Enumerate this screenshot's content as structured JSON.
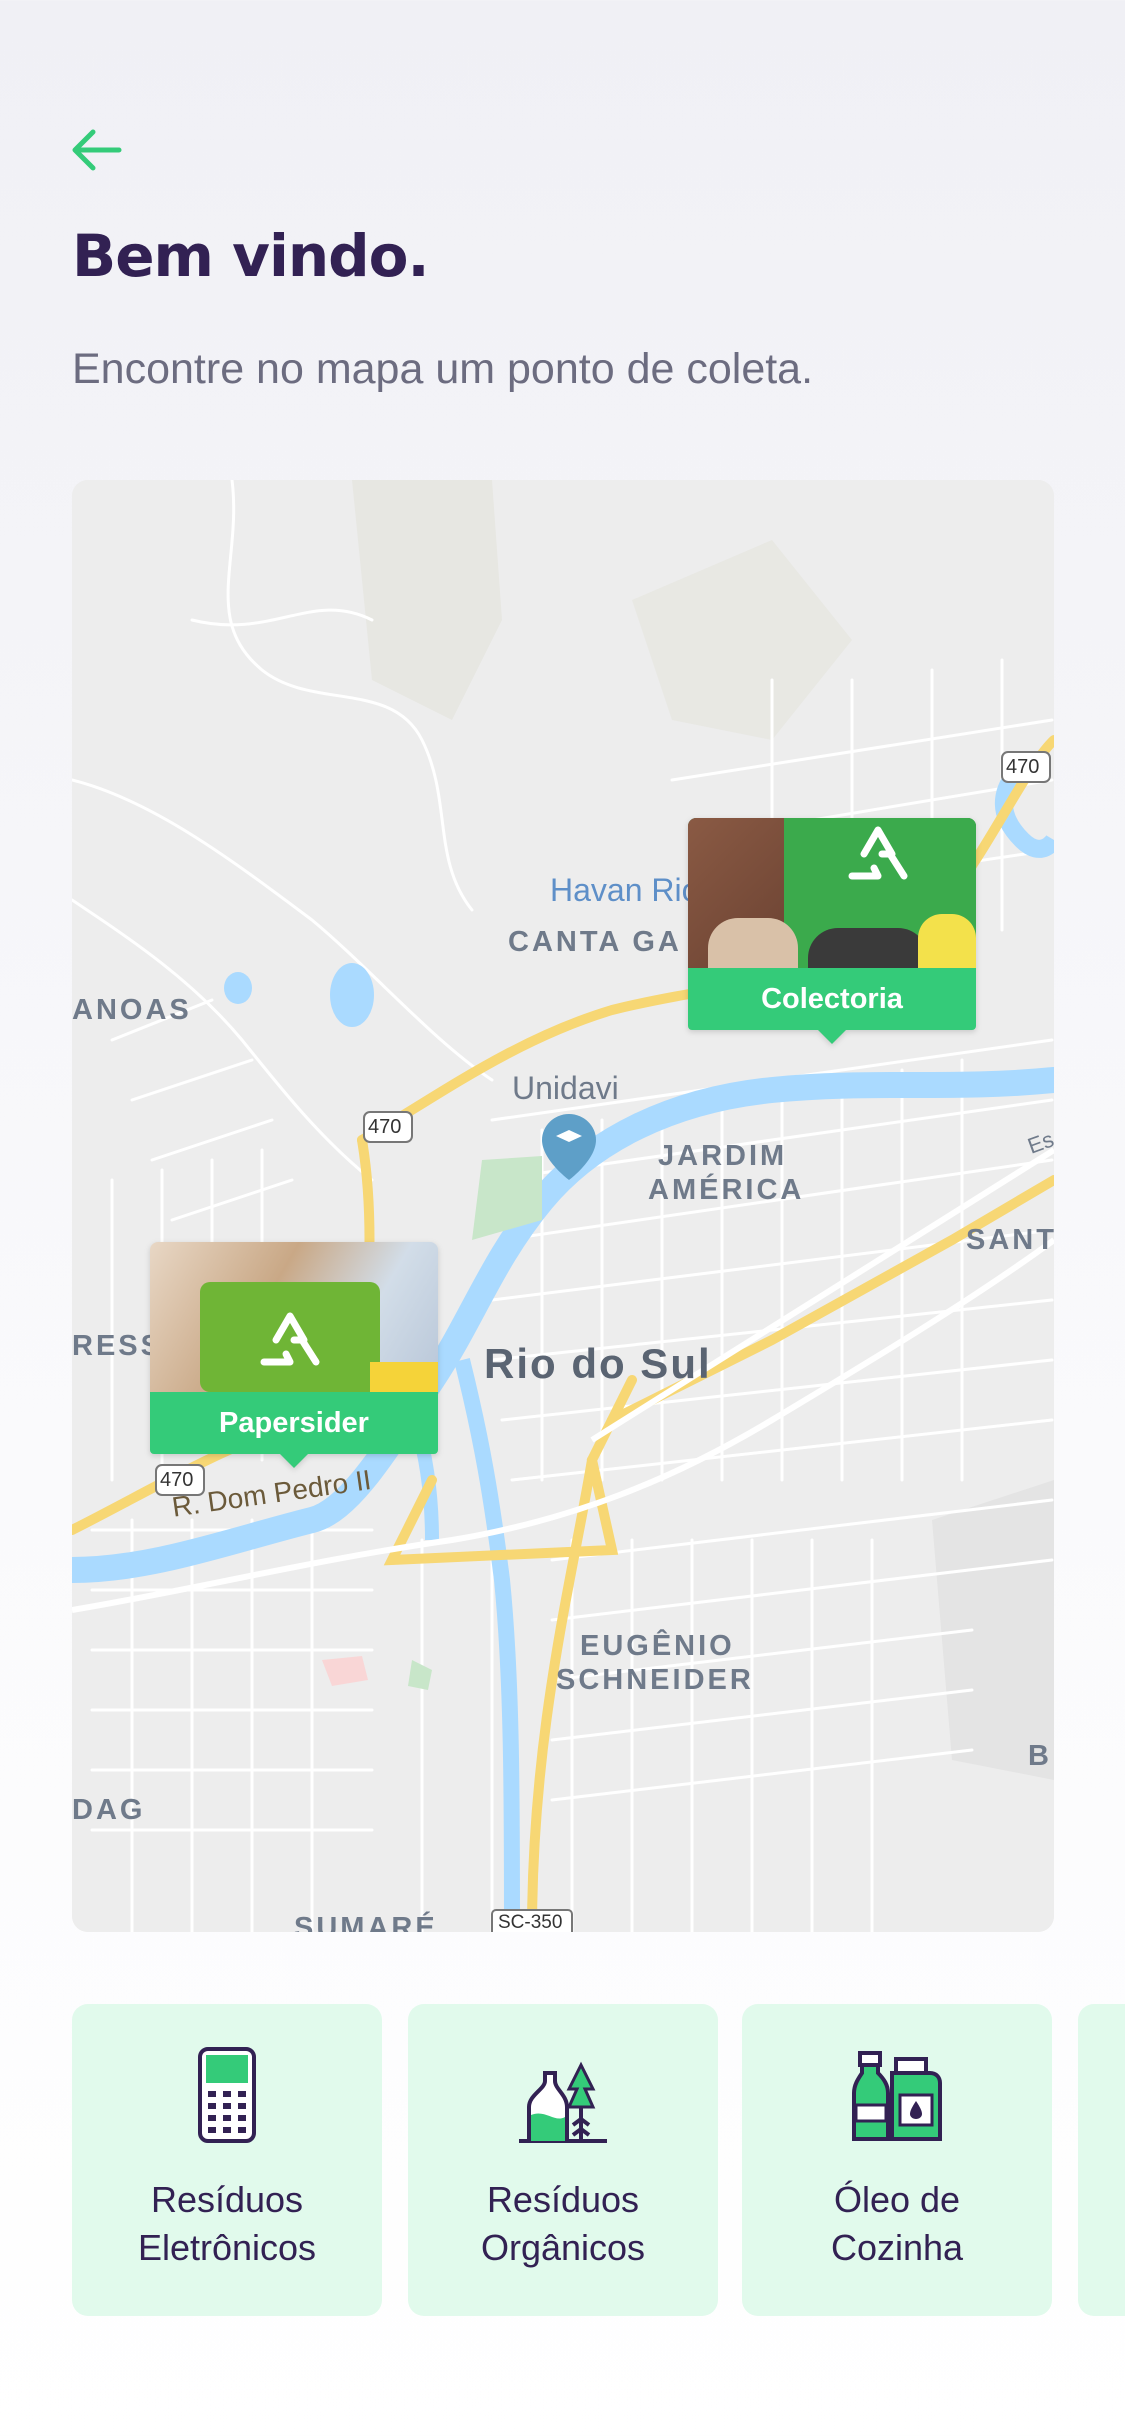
{
  "header": {
    "title": "Bem vindo.",
    "subtitle": "Encontre no mapa um ponto de coleta."
  },
  "colors": {
    "accent": "#34CB79",
    "title": "#322153",
    "text": "#6C6C80",
    "item_bg": "#E1FAEC"
  },
  "map": {
    "labels": {
      "havan": "Havan Rio",
      "canta_galo": "CANTA GA",
      "canoas": "ANOAS",
      "unidavi": "Unidavi",
      "jardim_1": "JARDIM",
      "jardim_2": "AMÉRICA",
      "santana": "SANT",
      "ress": "RESS",
      "city": "Rio do Sul",
      "street": "R. Dom Pedro II",
      "eugenio_1": "EUGÊNIO",
      "eugenio_2": "SCHNEIDER",
      "dag": "DAG",
      "b": "B",
      "sumare": "SUMARÉ",
      "road_470_a": "470",
      "road_470_b": "470",
      "road_470_c": "470",
      "road_sc350": "SC-350",
      "es": "Es"
    },
    "markers": [
      {
        "name": "Colectoria"
      },
      {
        "name": "Papersider"
      }
    ]
  },
  "items": [
    {
      "label": "Resíduos\nEletrônicos",
      "icon": "electronics-icon"
    },
    {
      "label": "Resíduos\nOrgânicos",
      "icon": "organic-icon"
    },
    {
      "label": "Óleo de\nCozinha",
      "icon": "cooking-oil-icon"
    }
  ]
}
